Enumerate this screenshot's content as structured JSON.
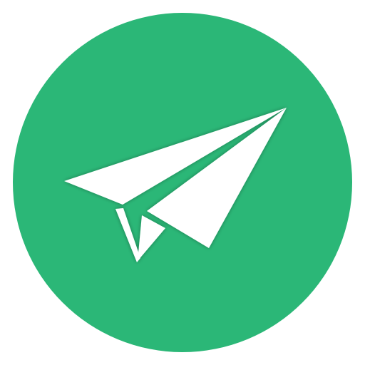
{
  "icon": {
    "name": "paper-plane-icon",
    "background_color": "#2BB777",
    "foreground_color": "#FFFFFF"
  }
}
